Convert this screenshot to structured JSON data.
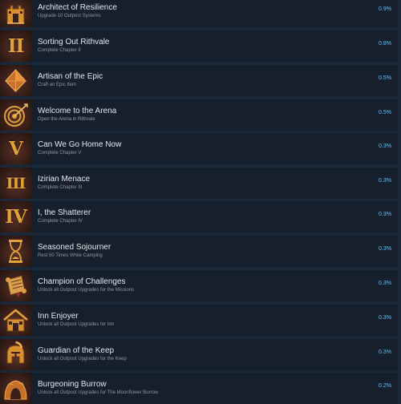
{
  "achievements": [
    {
      "title": "Architect of Resilience",
      "description": "Upgrade 10 Outpost Systems",
      "percent": "0.9%",
      "icon": "castle-icon",
      "glyph": ""
    },
    {
      "title": "Sorting Out Rithvale",
      "description": "Complete Chapter II",
      "percent": "0.8%",
      "icon": "roman-numeral-ii-icon",
      "glyph": "II"
    },
    {
      "title": "Artisan of the Epic",
      "description": "Craft an Epic Item",
      "percent": "0.5%",
      "icon": "pyramid-icon",
      "glyph": ""
    },
    {
      "title": "Welcome to the Arena",
      "description": "Open the Arena in Rithvale",
      "percent": "0.5%",
      "icon": "target-icon",
      "glyph": ""
    },
    {
      "title": "Can We Go Home Now",
      "description": "Complete Chapter V",
      "percent": "0.3%",
      "icon": "roman-numeral-v-icon",
      "glyph": "V"
    },
    {
      "title": "Izirian Menace",
      "description": "Complete Chapter III",
      "percent": "0.3%",
      "icon": "roman-numeral-iii-icon",
      "glyph": "III"
    },
    {
      "title": "I, the Shatterer",
      "description": "Complete Chapter IV",
      "percent": "0.3%",
      "icon": "roman-numeral-iv-icon",
      "glyph": "IV"
    },
    {
      "title": "Seasoned Sojourner",
      "description": "Rest 50 Times While Camping",
      "percent": "0.3%",
      "icon": "hourglass-icon",
      "glyph": ""
    },
    {
      "title": "Champion of Challenges",
      "description": "Unlock all Outpost Upgrades for the Missions",
      "percent": "0.3%",
      "icon": "scroll-icon",
      "glyph": ""
    },
    {
      "title": "Inn Enjoyer",
      "description": "Unlock all Outpost Upgrades for Inn",
      "percent": "0.3%",
      "icon": "house-icon",
      "glyph": ""
    },
    {
      "title": "Guardian of the Keep",
      "description": "Unlock all Outpost Upgrades for the Keep",
      "percent": "0.3%",
      "icon": "helmet-icon",
      "glyph": ""
    },
    {
      "title": "Burgeoning Burrow",
      "description": "Unlock all Outpost Upgrades for The Moonflower Burrow",
      "percent": "0.2%",
      "icon": "burrow-icon",
      "glyph": ""
    }
  ],
  "colors": {
    "background": "#1b2838",
    "row": "#16202d",
    "title": "#e4e8ec",
    "description": "#8f98a0",
    "percent": "#67c1f5",
    "icon_gold": "#e2a23a"
  }
}
